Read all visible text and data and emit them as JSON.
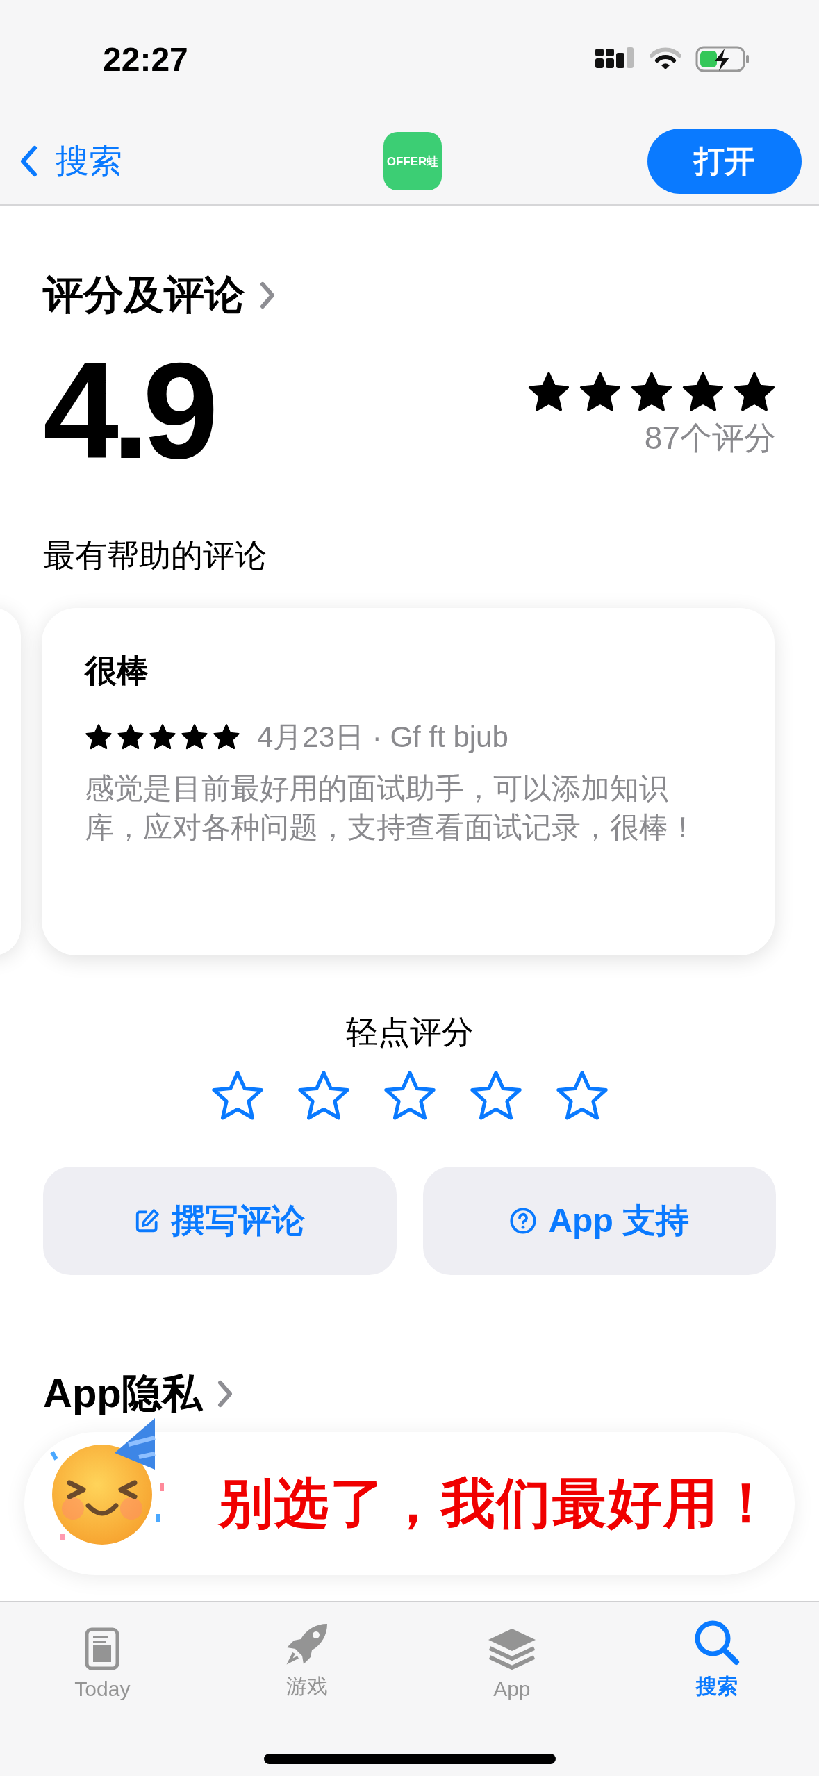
{
  "status_bar": {
    "time": "22:27"
  },
  "nav": {
    "back_label": "搜索",
    "app_logo_text": "OFFER蛙",
    "open_button": "打开"
  },
  "ratings": {
    "heading": "评分及评论",
    "score": "4.9",
    "stars": 5,
    "count": "87个评分"
  },
  "reviews_section": {
    "title": "最有帮助的评论",
    "reviews": [
      {
        "title": "很棒",
        "stars": 5,
        "meta": "4月23日 · Gf ft bjub",
        "body": "感觉是目前最好用的面试助手，可以添加知识库，应对各种问题，支持查看面试记录，很棒！"
      }
    ]
  },
  "tap_to_rate": {
    "label": "轻点评分",
    "stars": 0
  },
  "actions": [
    {
      "kind": "write",
      "label": "撰写评论"
    },
    {
      "kind": "support",
      "label": "App 支持"
    }
  ],
  "privacy": {
    "heading": "App隐私"
  },
  "banner": {
    "text": "别选了，我们最好用！"
  },
  "tabs": [
    {
      "kind": "today",
      "label": "Today",
      "selected": false
    },
    {
      "kind": "games",
      "label": "游戏",
      "selected": false
    },
    {
      "kind": "apps",
      "label": "App",
      "selected": false
    },
    {
      "kind": "search",
      "label": "搜索",
      "selected": true
    }
  ]
}
